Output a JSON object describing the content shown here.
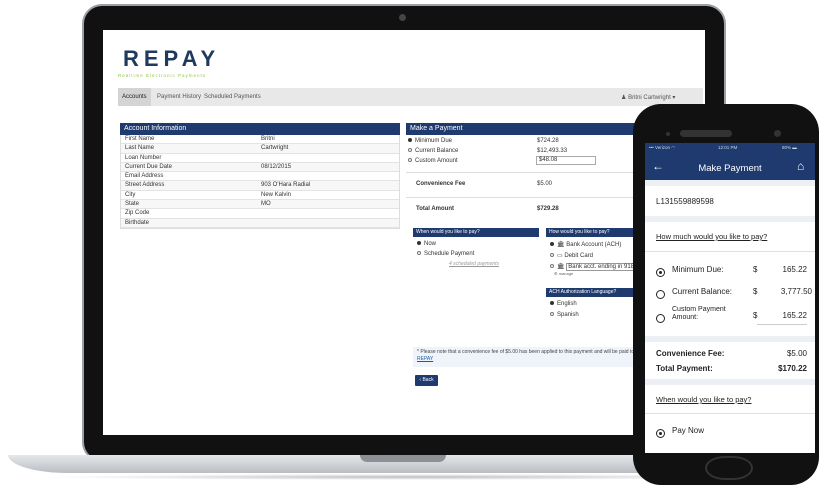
{
  "brand": {
    "logo_text": "REPAY",
    "tagline": "Realtime Electronic Payments",
    "accent": "#8dc63f",
    "navy": "#1e3a6e"
  },
  "nav": {
    "tabs": [
      "Accounts",
      "Payment History",
      "Scheduled Payments"
    ],
    "user": "Britni Cartwright"
  },
  "account_info": {
    "title": "Account Information",
    "rows": [
      {
        "label": "First Name",
        "value": "Britni"
      },
      {
        "label": "Last Name",
        "value": "Cartwright"
      },
      {
        "label": "Loan Number",
        "value": ""
      },
      {
        "label": "Current Due Date",
        "value": "08/12/2015"
      },
      {
        "label": "Email Address",
        "value": ""
      },
      {
        "label": "Street Address",
        "value": "903 O'Hara Radial"
      },
      {
        "label": "City",
        "value": "New Kalvin"
      },
      {
        "label": "State",
        "value": "MO"
      },
      {
        "label": "Zip Code",
        "value": ""
      },
      {
        "label": "Birthdate",
        "value": ""
      }
    ]
  },
  "payment": {
    "title": "Make a Payment",
    "options": [
      {
        "label": "Minimum Due",
        "value": "$724.28"
      },
      {
        "label": "Current Balance",
        "value": "$12,493.33"
      },
      {
        "label": "Custom Amount",
        "value": "$48.08"
      }
    ],
    "fee_label": "Convenience Fee",
    "fee_value": "$5.00",
    "total_label": "Total Amount",
    "total_value": "$729.28",
    "when_title": "When would you like to pay?",
    "when_options": [
      "Now",
      "Schedule Payment"
    ],
    "scheduled_link": "4 scheduled payments",
    "how_title": "How would you like to pay?",
    "how_options": [
      "Bank Account (ACH)",
      "Debit Card",
      "Bank acct. ending in 9185"
    ],
    "manage_link": "manage",
    "ach_title": "ACH Authorization Language?",
    "ach_options": [
      "English",
      "Spanish"
    ],
    "note": "* Please note that a convenience fee of $5.00 has been applied to this payment and will be paid to",
    "note_link": "REPAY",
    "back_label": "‹ Back"
  },
  "phone": {
    "carrier": "Verizon",
    "time": "12:01 PM",
    "battery": "80%",
    "title": "Make Payment",
    "account_number": "L131559889598",
    "how_much": "How much would you like to pay?",
    "options": [
      {
        "label": "Minimum Due:",
        "currency": "$",
        "amount": "165.22",
        "selected": true
      },
      {
        "label": "Current Balance:",
        "currency": "$",
        "amount": "3,777.50",
        "selected": false
      },
      {
        "label": "Custom Payment Amount:",
        "currency": "$",
        "amount": "165.22",
        "selected": false
      }
    ],
    "fee_label": "Convenience Fee:",
    "fee_value": "$5.00",
    "total_label": "Total Payment:",
    "total_value": "$170.22",
    "when": "When would you like to pay?",
    "pay_now": "Pay Now",
    "header_color": "#1e3a6e"
  }
}
